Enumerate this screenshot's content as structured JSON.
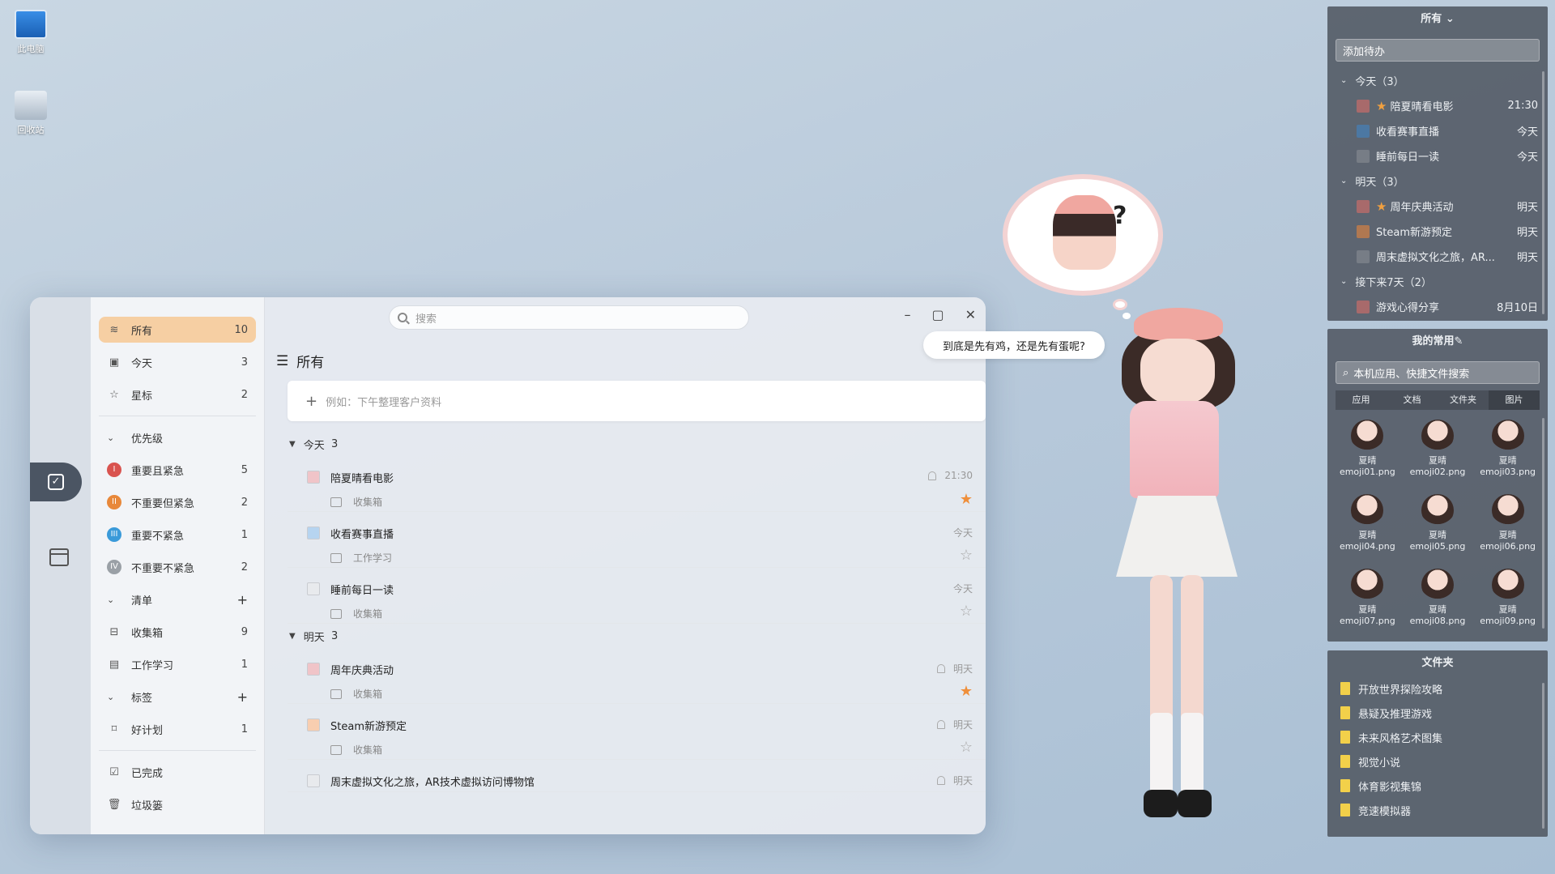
{
  "desktop": {
    "icons": [
      {
        "label": "此电脑",
        "icon": "computer-icon"
      },
      {
        "label": "回收站",
        "icon": "recycle-bin-icon"
      }
    ]
  },
  "app": {
    "search_placeholder": "搜索",
    "sidebar": {
      "all": {
        "label": "所有",
        "count": "10"
      },
      "today": {
        "label": "今天",
        "count": "3"
      },
      "starred": {
        "label": "星标",
        "count": "2"
      },
      "priority_header": "优先级",
      "priorities": [
        {
          "badge": "I",
          "label": "重要且紧急",
          "count": "5",
          "color": "#d9534f"
        },
        {
          "badge": "II",
          "label": "不重要但紧急",
          "count": "2",
          "color": "#e8883a"
        },
        {
          "badge": "III",
          "label": "重要不紧急",
          "count": "1",
          "color": "#3a9ad9"
        },
        {
          "badge": "IV",
          "label": "不重要不紧急",
          "count": "2",
          "color": "#9aa0a6"
        }
      ],
      "lists_header": "清单",
      "lists": [
        {
          "label": "收集箱",
          "count": "9"
        },
        {
          "label": "工作学习",
          "count": "1"
        }
      ],
      "tags_header": "标签",
      "tags": [
        {
          "label": "好计划",
          "count": "1"
        }
      ],
      "completed": "已完成",
      "trash": "垃圾篓"
    },
    "main": {
      "title": "所有",
      "add_placeholder": "例如：下午整理客户资料",
      "groups": [
        {
          "label": "今天",
          "count": "3"
        },
        {
          "label": "明天",
          "count": "3"
        }
      ],
      "tasks": [
        {
          "title": "陪夏晴看电影",
          "list": "收集箱",
          "due": "21:30",
          "box_color": "#f0c4c8",
          "starred": true,
          "bell": true
        },
        {
          "title": "收看赛事直播",
          "list": "工作学习",
          "due": "今天",
          "box_color": "#b6d4f0",
          "starred": false,
          "bell": false
        },
        {
          "title": "睡前每日一读",
          "list": "收集箱",
          "due": "今天",
          "box_color": "#e8eaed",
          "starred": false,
          "bell": false
        },
        {
          "title": "周年庆典活动",
          "list": "收集箱",
          "due": "明天",
          "box_color": "#f0c4c8",
          "starred": true,
          "bell": true
        },
        {
          "title": "Steam新游预定",
          "list": "收集箱",
          "due": "明天",
          "box_color": "#f8ceb0",
          "starred": false,
          "bell": true
        },
        {
          "title": "周末虚拟文化之旅，AR技术虚拟访问博物馆",
          "list": "",
          "due": "明天",
          "box_color": "#e8eaed",
          "starred": false,
          "bell": true
        }
      ]
    }
  },
  "bubbles": {
    "speech": "到底是先有鸡，还是先有蛋呢?",
    "thought_mark": "?"
  },
  "widget_todo": {
    "header": "所有",
    "add_label": "添加待办",
    "groups": [
      {
        "label": "今天（3）",
        "items": [
          {
            "title": "陪夏晴看电影",
            "due": "21:30",
            "star": true,
            "color": "#b06a6a"
          },
          {
            "title": "收看赛事直播",
            "due": "今天",
            "star": false,
            "color": "#4a7aa8"
          },
          {
            "title": "睡前每日一读",
            "due": "今天",
            "star": false,
            "color": "#7a8088"
          }
        ]
      },
      {
        "label": "明天（3）",
        "items": [
          {
            "title": "周年庆典活动",
            "due": "明天",
            "star": true,
            "color": "#b06a6a"
          },
          {
            "title": "Steam新游预定",
            "due": "明天",
            "star": false,
            "color": "#b97a4e"
          },
          {
            "title": "周末虚拟文化之旅，AR...",
            "due": "明天",
            "star": false,
            "color": "#7a8088"
          }
        ]
      },
      {
        "label": "接下来7天（2）",
        "items": [
          {
            "title": "游戏心得分享",
            "due": "8月10日",
            "star": false,
            "color": "#b06a6a"
          }
        ]
      }
    ]
  },
  "widget_fav": {
    "header": "我的常用",
    "search_placeholder": "本机应用、快捷文件搜索",
    "tabs": [
      "应用",
      "文档",
      "文件夹",
      "图片"
    ],
    "active_tab": 3,
    "files": [
      {
        "top": "夏晴",
        "name": "emoji01.png"
      },
      {
        "top": "夏晴",
        "name": "emoji02.png"
      },
      {
        "top": "夏晴",
        "name": "emoji03.png"
      },
      {
        "top": "夏晴",
        "name": "emoji04.png"
      },
      {
        "top": "夏晴",
        "name": "emoji05.png"
      },
      {
        "top": "夏晴",
        "name": "emoji06.png"
      },
      {
        "top": "夏晴",
        "name": "emoji07.png"
      },
      {
        "top": "夏晴",
        "name": "emoji08.png"
      },
      {
        "top": "夏晴",
        "name": "emoji09.png"
      }
    ]
  },
  "widget_folders": {
    "header": "文件夹",
    "items": [
      "开放世界探险攻略",
      "悬疑及推理游戏",
      "未来风格艺术图集",
      "视觉小说",
      "体育影视集锦",
      "竞速模拟器"
    ]
  }
}
